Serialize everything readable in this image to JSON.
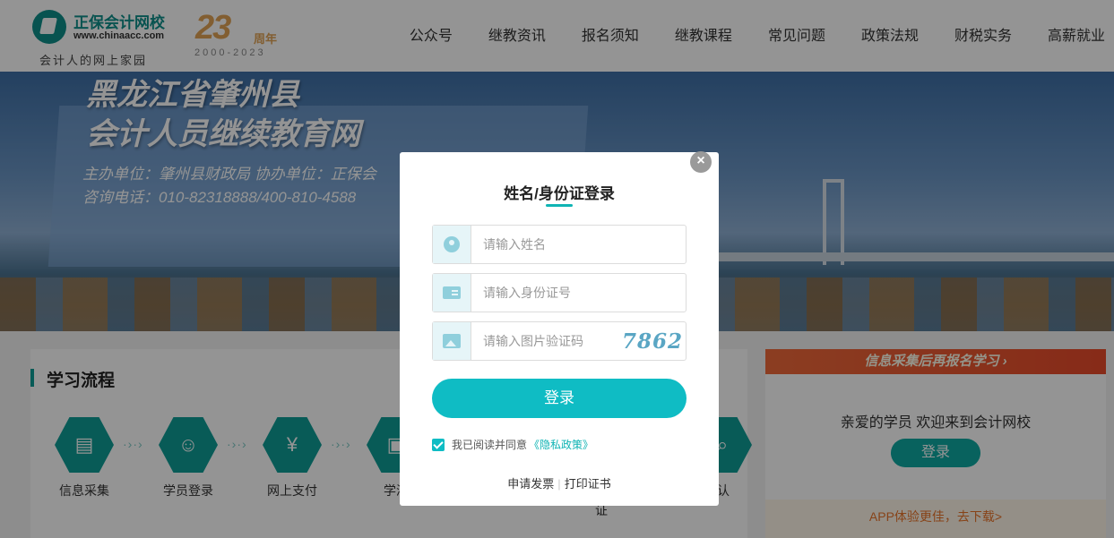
{
  "header": {
    "logo_main": "正保会计网校",
    "logo_url": "www.chinaacc.com",
    "slogan": "会计人的网上家园",
    "anniv_number": "23",
    "anniv_word": "周年",
    "anniv_years": "2000-2023"
  },
  "nav": [
    "公众号",
    "继教资讯",
    "报名须知",
    "继教课程",
    "常见问题",
    "政策法规",
    "财税实务",
    "高薪就业"
  ],
  "banner": {
    "line1": "黑龙江省肇州县",
    "line2": "会计人员继续教育网",
    "org": "主办单位：肇州县财政局   协办单位：正保会",
    "tel": "咨询电话：010-82318888/400-810-4588"
  },
  "flow": {
    "title": "学习流程",
    "steps": [
      "信息采集",
      "学员登录",
      "网上支付",
      "学满"
    ],
    "partial_right": "认",
    "partial_bottom": "证"
  },
  "side": {
    "banner": "信息采集后再报名学习 ›",
    "welcome": "亲爱的学员 欢迎来到会计网校",
    "login": "登录",
    "app": "APP体验更佳，去下载>"
  },
  "modal": {
    "close": "×",
    "title": "姓名/身份证登录",
    "name_placeholder": "请输入姓名",
    "id_placeholder": "请输入身份证号",
    "captcha_placeholder": "请输入图片验证码",
    "captcha_code": "7862",
    "login": "登录",
    "agree_text": "我已阅读并同意",
    "privacy": "《隐私政策》",
    "invoice": "申请发票",
    "separator": "|",
    "certificate": "打印证书"
  },
  "colors": {
    "accent": "#0fbcc4",
    "brand": "#0f8f8a"
  }
}
